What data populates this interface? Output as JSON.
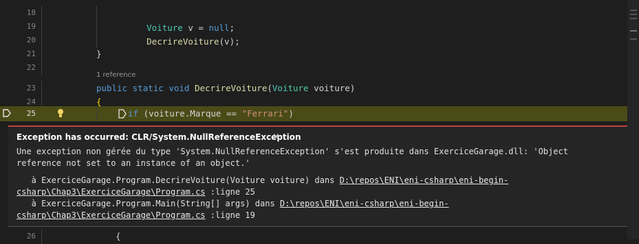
{
  "editor": {
    "lines": [
      {
        "num": "18",
        "code": [
          {
            "t": "Voiture ",
            "c": "type"
          },
          {
            "t": "v = ",
            "c": ""
          },
          {
            "t": "null",
            "c": "kw"
          },
          {
            "t": ";",
            "c": ""
          }
        ]
      },
      {
        "num": "19",
        "code": [
          {
            "t": "DecrireVoiture",
            "c": "fn"
          },
          {
            "t": "(v);",
            "c": ""
          }
        ]
      },
      {
        "num": "20",
        "code": []
      },
      {
        "num": "21",
        "code": [
          {
            "t": "}",
            "c": ""
          }
        ]
      },
      {
        "num": "22",
        "code": []
      }
    ],
    "codelens": "1 reference",
    "line23": {
      "num": "23",
      "kw1": "public static void ",
      "fn": "DecrireVoiture",
      "p1": "(",
      "type": "Voiture",
      "p2": " voiture)"
    },
    "line24": {
      "num": "24",
      "code": "{"
    },
    "line25": {
      "num": "25",
      "kw": "if ",
      "p1": "(voiture.Marque == ",
      "str": "\"Ferrari\"",
      "p2": ")"
    },
    "line26": {
      "num": "26",
      "code": "{"
    }
  },
  "exception": {
    "title": "Exception has occurred: CLR/System.NullReferenceException",
    "close": "×",
    "message_line1": "Une exception non gérée du type 'System.NullReferenceException' s'est produite dans ExerciceGarage.dll: 'Object",
    "message_line2": "reference not set to an instance of an object.'",
    "stack": [
      {
        "prefix": "   à ExerciceGarage.Program.DecrireVoiture(Voiture voiture) dans ",
        "path_a": "D:\\repos\\ENI\\eni-csharp\\eni-begin-",
        "path_b": "csharp\\Chap3\\ExerciceGarage\\Program.cs",
        "suffix": " :ligne 25"
      },
      {
        "prefix": "   à ExerciceGarage.Program.Main(String[] args) dans ",
        "path_a": "D:\\repos\\ENI\\eni-csharp\\eni-begin-",
        "path_b": "csharp\\Chap3\\ExerciceGarage\\Program.cs",
        "suffix": " :ligne 19"
      }
    ]
  },
  "colors": {
    "exception_border": "#c24040",
    "current_line": "#4b4b18",
    "keyword": "#569cd6",
    "type": "#4ec9b0",
    "function": "#dcdcaa",
    "string": "#ce9178"
  },
  "icons": [
    "breakpoint-arrow-icon",
    "lightbulb-icon",
    "inline-breakpoint-icon",
    "close-icon"
  ]
}
